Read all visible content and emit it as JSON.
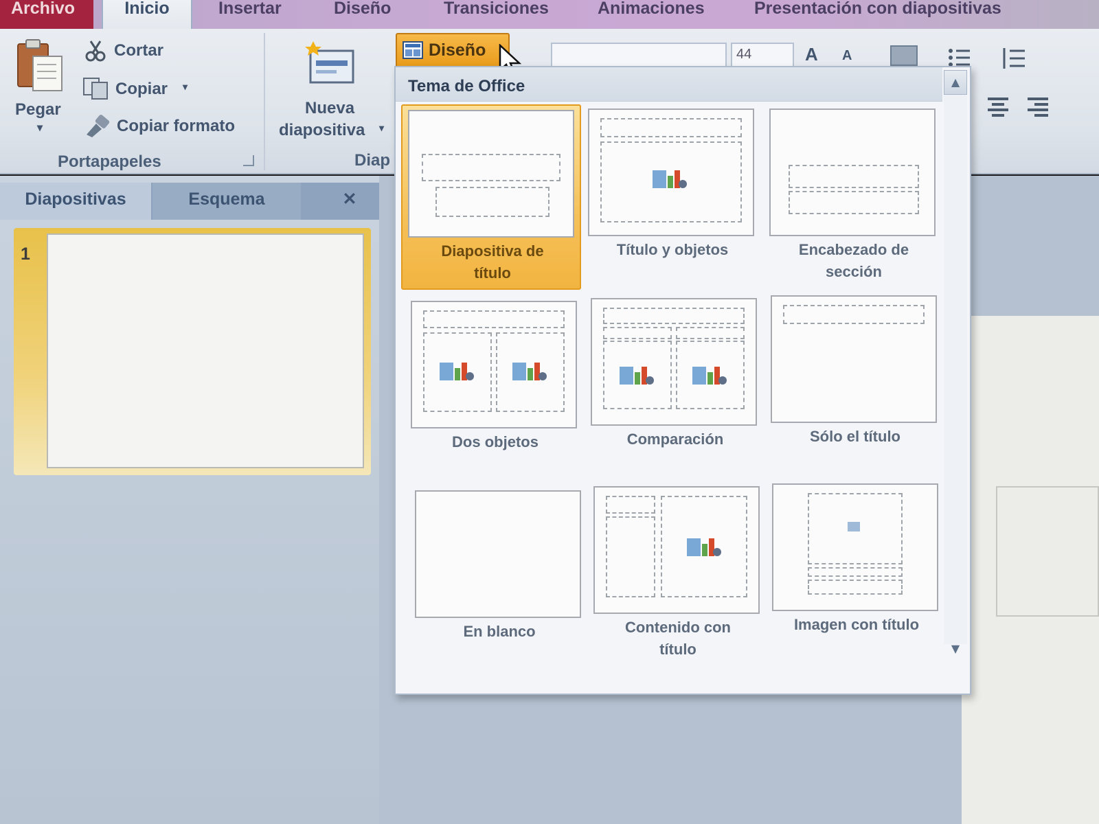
{
  "tabs": {
    "file": "Archivo",
    "home": "Inicio",
    "insert": "Insertar",
    "design": "Diseño",
    "transitions": "Transiciones",
    "animations": "Animaciones",
    "slideshow": "Presentación con diapositivas"
  },
  "ribbon": {
    "paste": "Pegar",
    "cut": "Cortar",
    "copy": "Copiar",
    "format_painter": "Copiar formato",
    "clipboard_group": "Portapapeles",
    "new_slide_line1": "Nueva",
    "new_slide_line2": "diapositiva",
    "slides_group": "Diap",
    "layout_button": "Diseño",
    "font_size": "44"
  },
  "left_pane": {
    "tab_slides": "Diapositivas",
    "tab_outline": "Esquema",
    "close": "✕",
    "slide_number": "1"
  },
  "gallery": {
    "header": "Tema de Office",
    "layouts": [
      {
        "line1": "Diapositiva de",
        "line2": "título"
      },
      {
        "line1": "Título y objetos",
        "line2": ""
      },
      {
        "line1": "Encabezado de",
        "line2": "sección"
      },
      {
        "line1": "Dos objetos",
        "line2": ""
      },
      {
        "line1": "Comparación",
        "line2": ""
      },
      {
        "line1": "Sólo el título",
        "line2": ""
      },
      {
        "line1": "En blanco",
        "line2": ""
      },
      {
        "line1": "Contenido con",
        "line2": "título"
      },
      {
        "line1": "Imagen con título",
        "line2": ""
      }
    ]
  },
  "colors": {
    "accent_orange": "#f2b440",
    "file_tab": "#a4233f"
  }
}
